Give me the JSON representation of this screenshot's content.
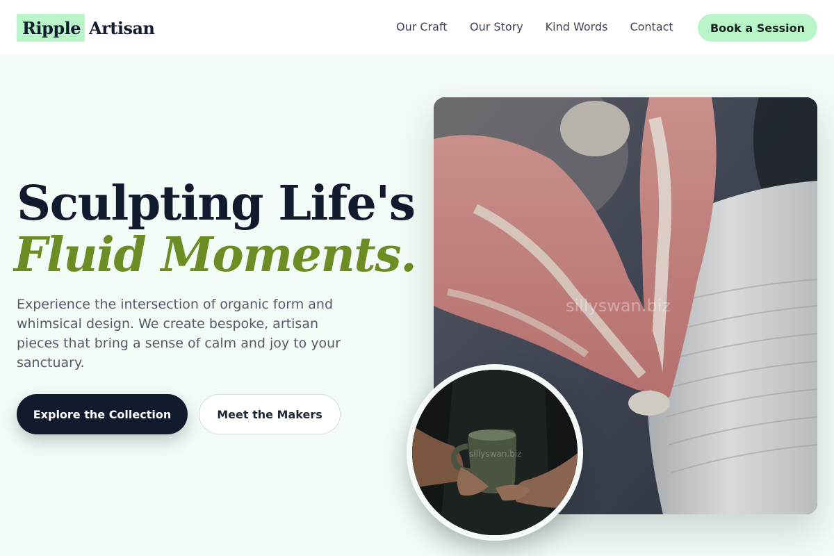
{
  "brand": {
    "logo_highlight": "Ripple",
    "logo_rest": "Artisan",
    "accent_color": "#b9f5c8",
    "headline_accent_color": "#6b8d24"
  },
  "nav": {
    "items": [
      "Our Craft",
      "Our Story",
      "Kind Words",
      "Contact"
    ],
    "cta_label": "Book a Session"
  },
  "hero": {
    "title_line1": "Sculpting Life's",
    "title_line2": "Fluid Moments.",
    "description": "Experience the intersection of organic form and whimsical design. We create bespoke, artisan pieces that bring a sense of calm and joy to your sanctuary.",
    "primary_button": "Explore the Collection",
    "secondary_button": "Meet the Makers"
  },
  "images": {
    "main_watermark": "sillyswan.biz",
    "circle_watermark": "sillyswan.biz",
    "main_subject": "hands-shaping-clay-on-pottery-wheel",
    "circle_subject": "hands-holding-ceramic-mug"
  }
}
